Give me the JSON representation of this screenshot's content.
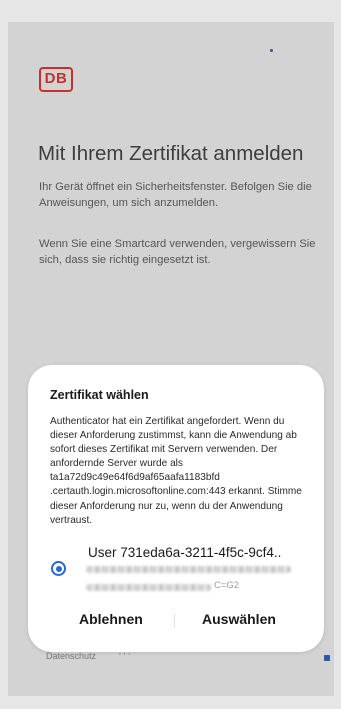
{
  "page": {
    "logo_text": "DB",
    "title": "Mit Ihrem Zertifikat anmelden",
    "paragraph_1": "Ihr Gerät öffnet ein Sicherheitsfenster. Befolgen Sie die Anweisungen, um sich anzumelden.",
    "paragraph_2": "Wenn Sie eine Smartcard verwenden, vergewissern Sie sich, dass sie richtig eingesetzt ist.",
    "footer_link": "Datenschutz",
    "footer_more": "···"
  },
  "dialog": {
    "title": "Zertifikat wählen",
    "body": "Authenticator hat ein Zertifikat angefordert. Wenn du dieser Anforderung zustimmst, kann die Anwendung ab sofort dieses Zertifikat mit Servern verwenden. Der anfordernde Server wurde als ta1a72d9c49e64f6d9af65aafa1183bfd .certauth.login.microsoftonline.com:443 erkannt. Stimme dieser Anforderung nur zu, wenn du der Anwendung vertraust.",
    "certificate": {
      "user": "User 731eda6a-3211-4f5c-9cf4..",
      "suffix": "C=G2",
      "selected": true
    },
    "decline_label": "Ablehnen",
    "select_label": "Auswählen"
  },
  "colors": {
    "accent": "#2a66d4",
    "brand_red": "#c8302c",
    "dim_background": "#d3d3d3"
  },
  "icons": [
    "radio-selected-icon",
    "more-icon"
  ]
}
